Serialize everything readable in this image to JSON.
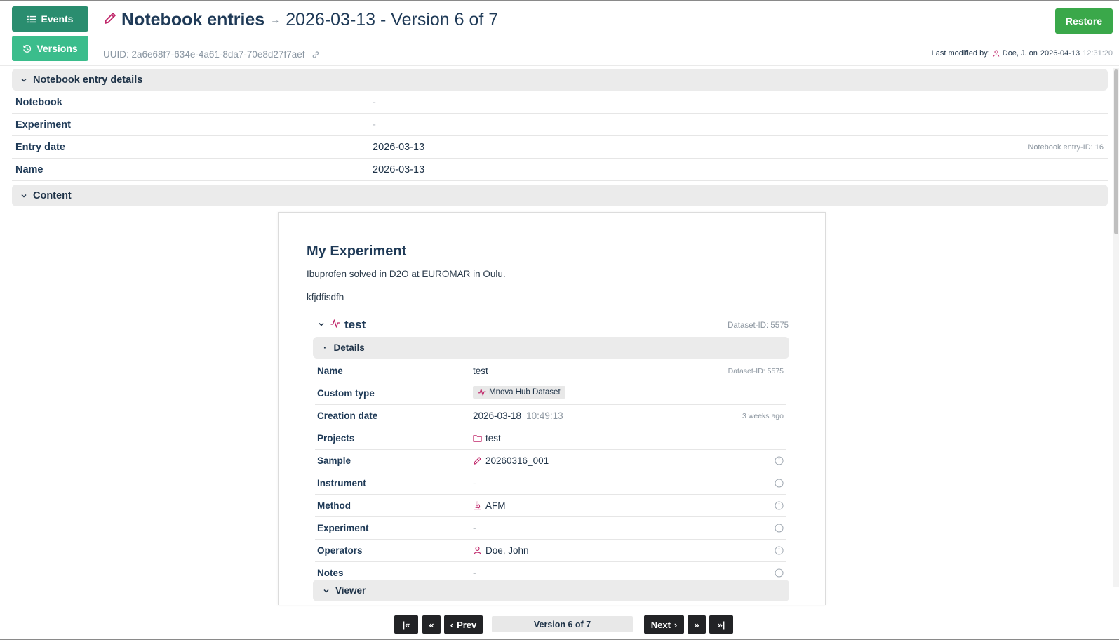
{
  "sidebar": {
    "events_label": "Events",
    "versions_label": "Versions"
  },
  "header": {
    "module": "Notebook entries",
    "record_title": "2026-03-13 - Version 6 of 7",
    "uuid": "UUID: 2a6e68f7-634e-4a61-8da7-70e8d27f7aef",
    "restore_label": "Restore",
    "last_modified_prefix": "Last modified by:",
    "last_modified_user": "Doe, J. on",
    "last_modified_date": "2026-04-13",
    "last_modified_time": "12:31:20"
  },
  "details_section": {
    "title": "Notebook entry details",
    "rows": [
      {
        "key": "Notebook",
        "value": "-"
      },
      {
        "key": "Experiment",
        "value": "-"
      },
      {
        "key": "Entry date",
        "value": "2026-03-13",
        "aside": "Notebook entry-ID: 16"
      },
      {
        "key": "Name",
        "value": "2026-03-13"
      }
    ]
  },
  "content_section": {
    "title": "Content",
    "heading": "My Experiment",
    "paragraph1": "Ibuprofen solved in D2O at EUROMAR in Oulu.",
    "paragraph2": "kfjdfisdfh",
    "dataset": {
      "name": "test",
      "dataset_id": "Dataset-ID: 5575",
      "details_title": "Details",
      "rows": [
        {
          "key": "Name",
          "value": "test",
          "aside": "Dataset-ID: 5575"
        },
        {
          "key": "Custom type",
          "value": "Mnova Hub Dataset"
        },
        {
          "key": "Creation date",
          "value": "2026-03-18",
          "time": "10:49:13",
          "aside": "3 weeks ago"
        },
        {
          "key": "Projects",
          "value": "test"
        },
        {
          "key": "Sample",
          "value": "20260316_001"
        },
        {
          "key": "Instrument",
          "value": "-"
        },
        {
          "key": "Method",
          "value": "AFM"
        },
        {
          "key": "Experiment",
          "value": "-"
        },
        {
          "key": "Operators",
          "value": "Doe, John"
        },
        {
          "key": "Notes",
          "value": "-"
        }
      ],
      "viewer_title": "Viewer"
    }
  },
  "pagination": {
    "prev_label": "Prev",
    "next_label": "Next",
    "version_label": "Version 6 of 7"
  },
  "colors": {
    "events_button": "#2a8d6f",
    "versions_button": "#3bbd8c",
    "restore_button": "#3aa84a",
    "accent_icon": "#c0276a"
  }
}
